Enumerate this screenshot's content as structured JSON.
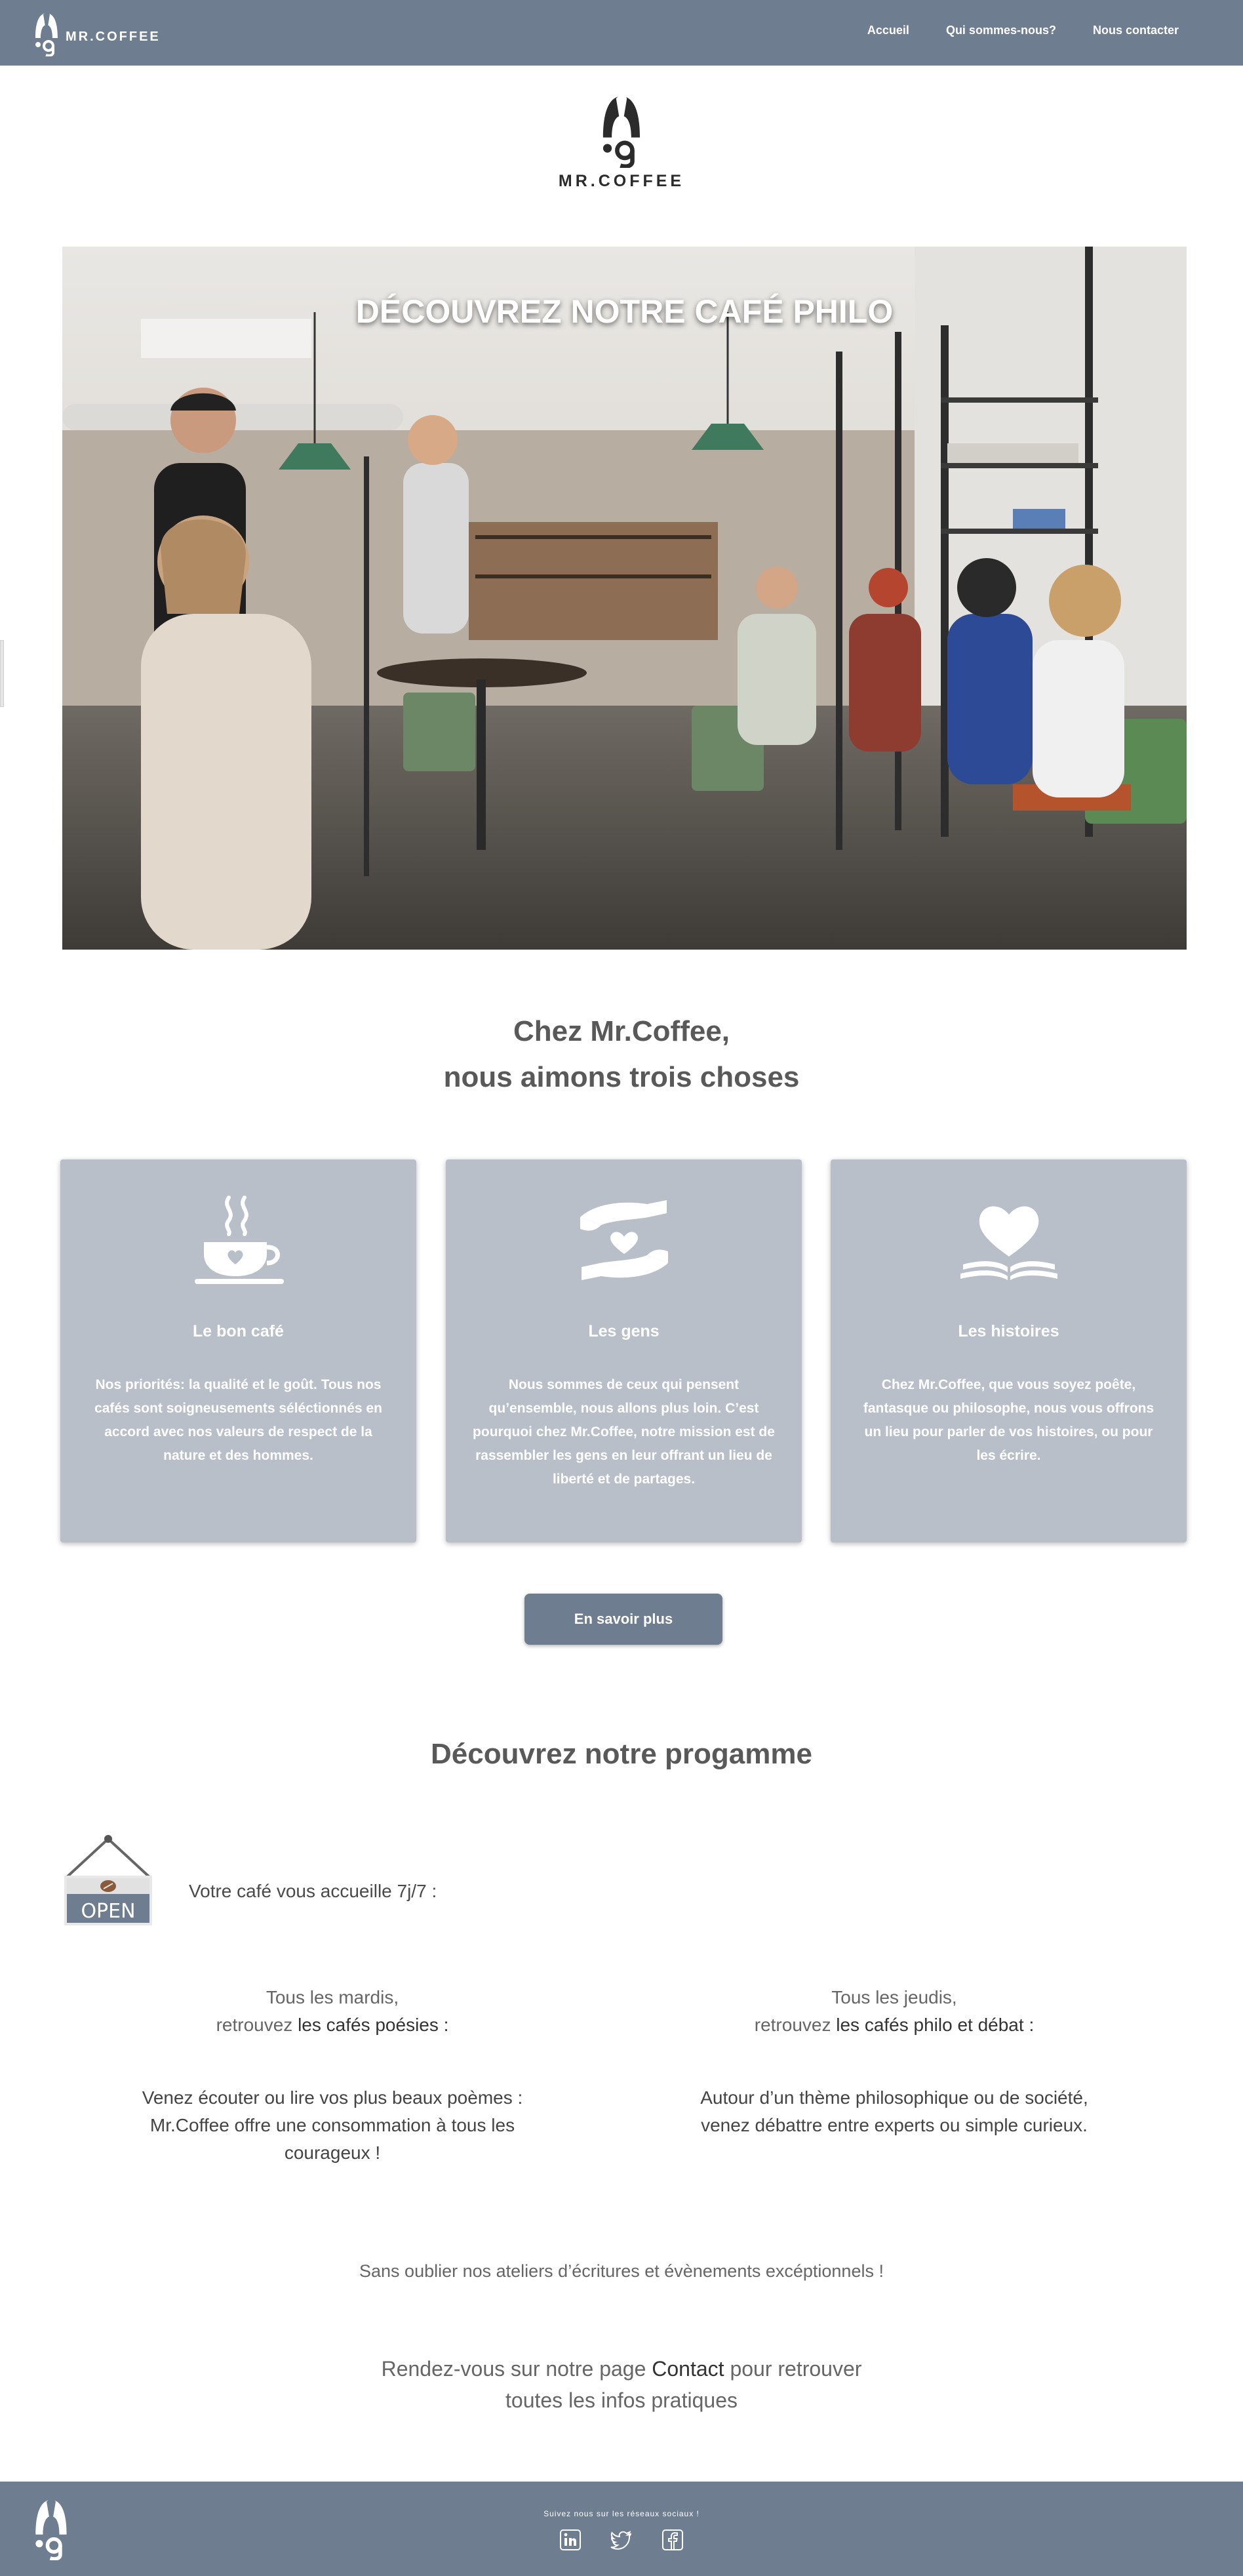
{
  "nav": {
    "logo_text": "MR.COFFEE",
    "links": [
      "Accueil",
      "Qui sommes-nous?",
      "Nous contacter"
    ]
  },
  "brand": {
    "logo_text": "MR.COFFEE"
  },
  "hero": {
    "title": "DÉCOUVREZ NOTRE CAFÉ PHILO"
  },
  "intro": {
    "line1": "Chez Mr.Coffee,",
    "line2": "nous aimons trois choses"
  },
  "cards": [
    {
      "icon": "coffee-cup-heart-icon",
      "title": "Le bon café",
      "text": "Nos priorités: la qualité et le goût. Tous nos cafés sont soigneusements séléctionnés en accord avec nos valeurs de respect de la nature et des hommes."
    },
    {
      "icon": "hands-heart-icon",
      "title": "Les gens",
      "text": "Nous sommes de ceux qui pensent qu’ensemble, nous allons plus loin. C’est pourquoi chez Mr.Coffee, notre mission est de rassembler les gens en leur offrant un lieu de liberté et de partages."
    },
    {
      "icon": "book-heart-icon",
      "title": "Les histoires",
      "text": "Chez Mr.Coffee, que vous soyez poête, fantasque ou philosophe, nous vous offrons un lieu pour parler de vos histoires, ou pour les écrire."
    }
  ],
  "more_button": "En savoir plus",
  "program": {
    "title": "Découvrez notre progamme",
    "open_sign_text": "OPEN",
    "open_line": "Votre café vous accueille 7j/7 :",
    "tuesday": {
      "line1": "Tous les mardis,",
      "prefix": "retrouvez ",
      "highlight": "les cafés poésies :",
      "desc": "Venez écouter ou lire vos plus beaux poèmes : Mr.Coffee offre une consommation à tous les courageux !"
    },
    "thursday": {
      "line1": "Tous les jeudis,",
      "prefix": "retrouvez ",
      "highlight": "les cafés philo et débat :",
      "desc": "Autour d’un thème philosophique ou de société, venez débattre entre experts ou simple curieux."
    },
    "extra": "Sans oublier nos ateliers d’écritures et évènements excéptionnels !",
    "contact_prefix": "Rendez-vous sur notre page ",
    "contact_word": "Contact",
    "contact_suffix": " pour retrouver",
    "contact_line2": "toutes les infos pratiques"
  },
  "footer": {
    "follow_text": "Suivez nous sur les réseaux sociaux !",
    "socials": [
      "linkedin-icon",
      "twitter-icon",
      "facebook-icon"
    ]
  },
  "colors": {
    "nav_bg": "#6e7d90",
    "card_bg": "#b8bfc8",
    "title_text": "#595959"
  }
}
